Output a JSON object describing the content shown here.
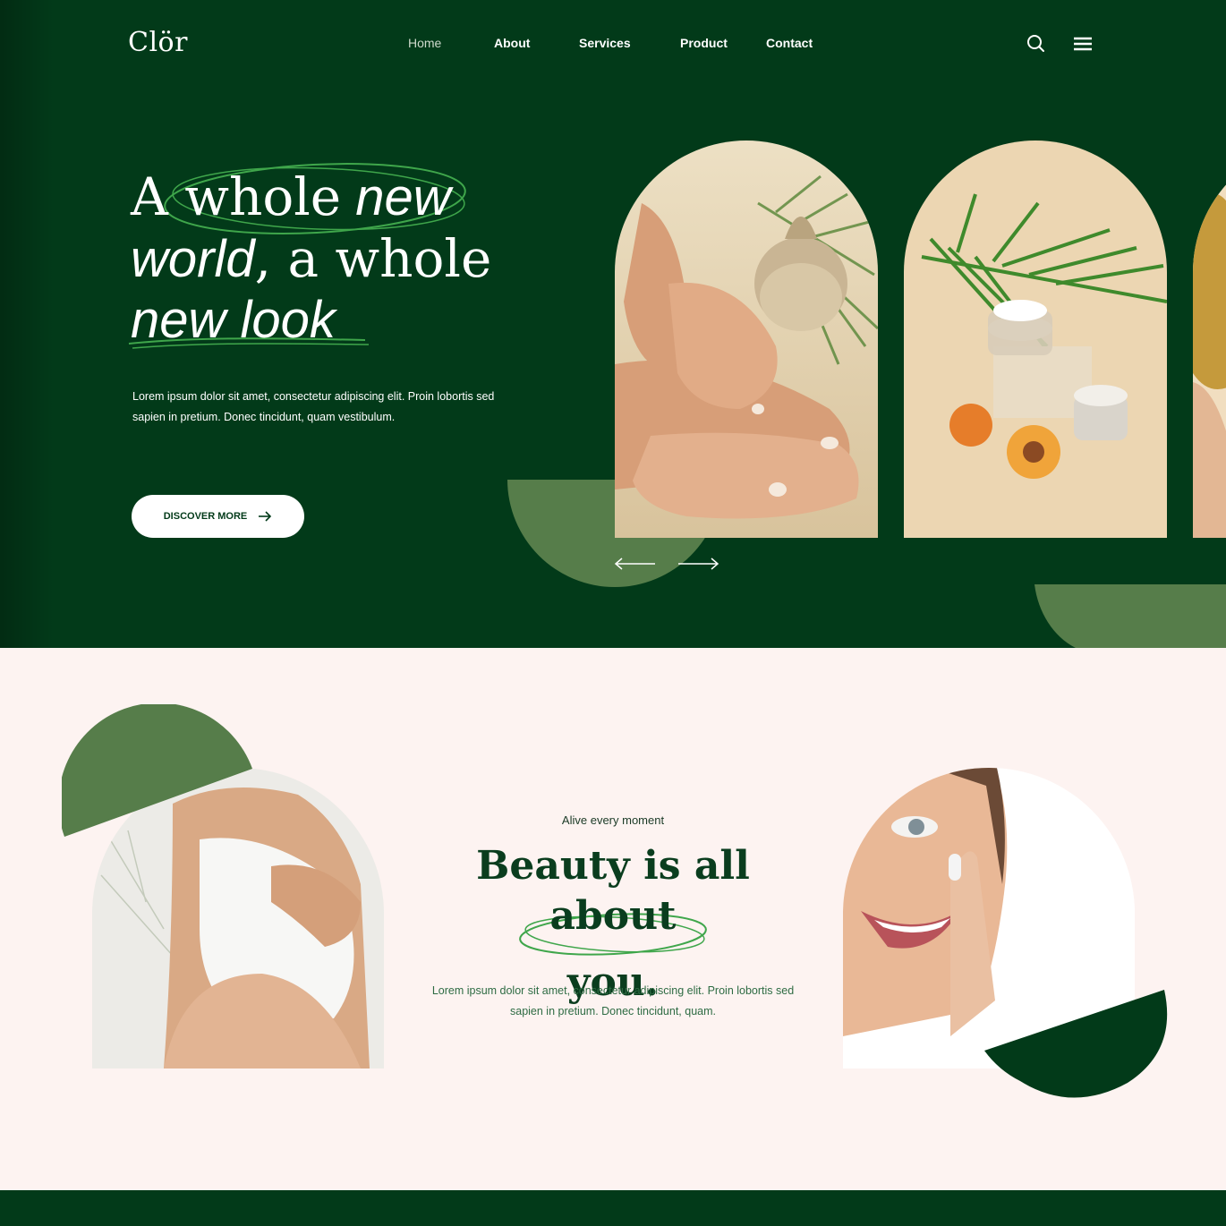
{
  "brand": {
    "logo": "Clör"
  },
  "nav": {
    "items": [
      {
        "label": "Home",
        "active": true
      },
      {
        "label": "About",
        "active": false
      },
      {
        "label": "Services",
        "active": false
      },
      {
        "label": "Product",
        "active": false
      },
      {
        "label": "Contact",
        "active": false
      }
    ],
    "icons": [
      "search-icon",
      "menu-icon"
    ]
  },
  "hero": {
    "title_line1_serif": "A whole",
    "title_line1_italic": "new",
    "title_line2_italic": "world",
    "title_line2_serif": ", a whole",
    "title_line3_italic": "new look",
    "description": "Lorem ipsum dolor sit amet, consectetur adipiscing elit. Proin lobortis sed sapien in pretium. Donec tincidunt, quam vestibulum.",
    "cta_label": "DISCOVER MORE"
  },
  "beauty": {
    "kicker": "Alive every moment",
    "title_line1": "Beauty is all about",
    "title_line2": "you.",
    "description": "Lorem ipsum dolor sit amet, consectetur adipiscing elit. Proin lobortis sed sapien in pretium. Donec tincidunt, quam."
  },
  "colors": {
    "dark_green": "#023a19",
    "mid_green": "#567d4a",
    "accent_green": "#3fa64b",
    "blush": "#fdf3f1"
  }
}
